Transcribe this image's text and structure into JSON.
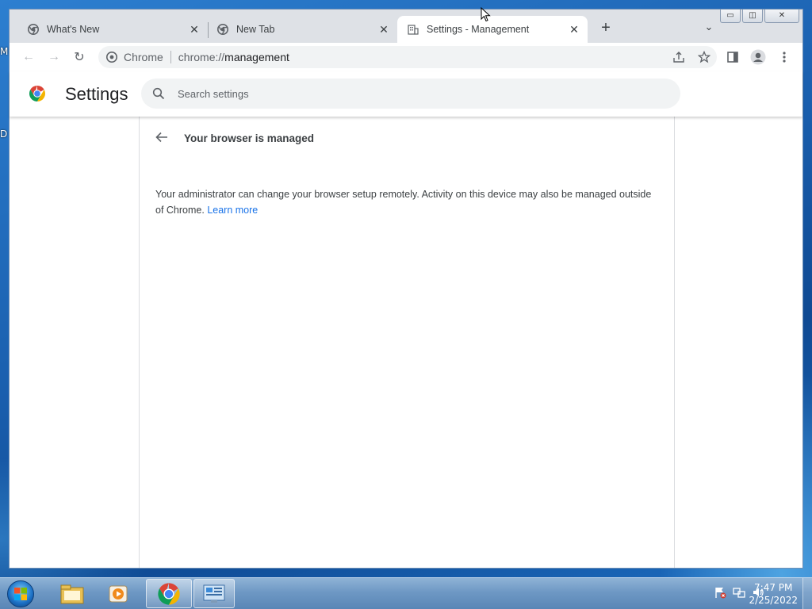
{
  "desktop": {
    "left_letters": [
      "M",
      "D"
    ]
  },
  "browser": {
    "tabs": [
      {
        "title": "What's New",
        "icon": "chrome-icon",
        "active": false,
        "close": "✕"
      },
      {
        "title": "New Tab",
        "icon": "chrome-icon",
        "active": false,
        "close": "✕"
      },
      {
        "title": "Settings - Management",
        "icon": "building-icon",
        "active": true,
        "close": "✕"
      }
    ],
    "new_tab_symbol": "+",
    "tab_search_symbol": "⌄",
    "window_controls": {
      "minimize": "▭",
      "maximize": "◫",
      "close": "✕"
    },
    "toolbar": {
      "back": "←",
      "forward": "→",
      "reload": "↻",
      "chip_label": "Chrome",
      "url_scheme": "chrome://",
      "url_host": "management"
    }
  },
  "settings": {
    "title": "Settings",
    "search_placeholder": "Search settings",
    "page_title": "Your browser is managed",
    "description": "Your administrator can change your browser setup remotely. Activity on this device may also be managed outside of Chrome.",
    "learn_more": "Learn more"
  },
  "taskbar": {
    "clock_time": "7:47 PM",
    "clock_date": "2/25/2022",
    "items": [
      "file-explorer",
      "media-player",
      "chrome",
      "control-panel"
    ]
  },
  "colors": {
    "link": "#1a73e8",
    "tab_strip": "#dee1e6",
    "omnibox": "#f1f3f4"
  }
}
